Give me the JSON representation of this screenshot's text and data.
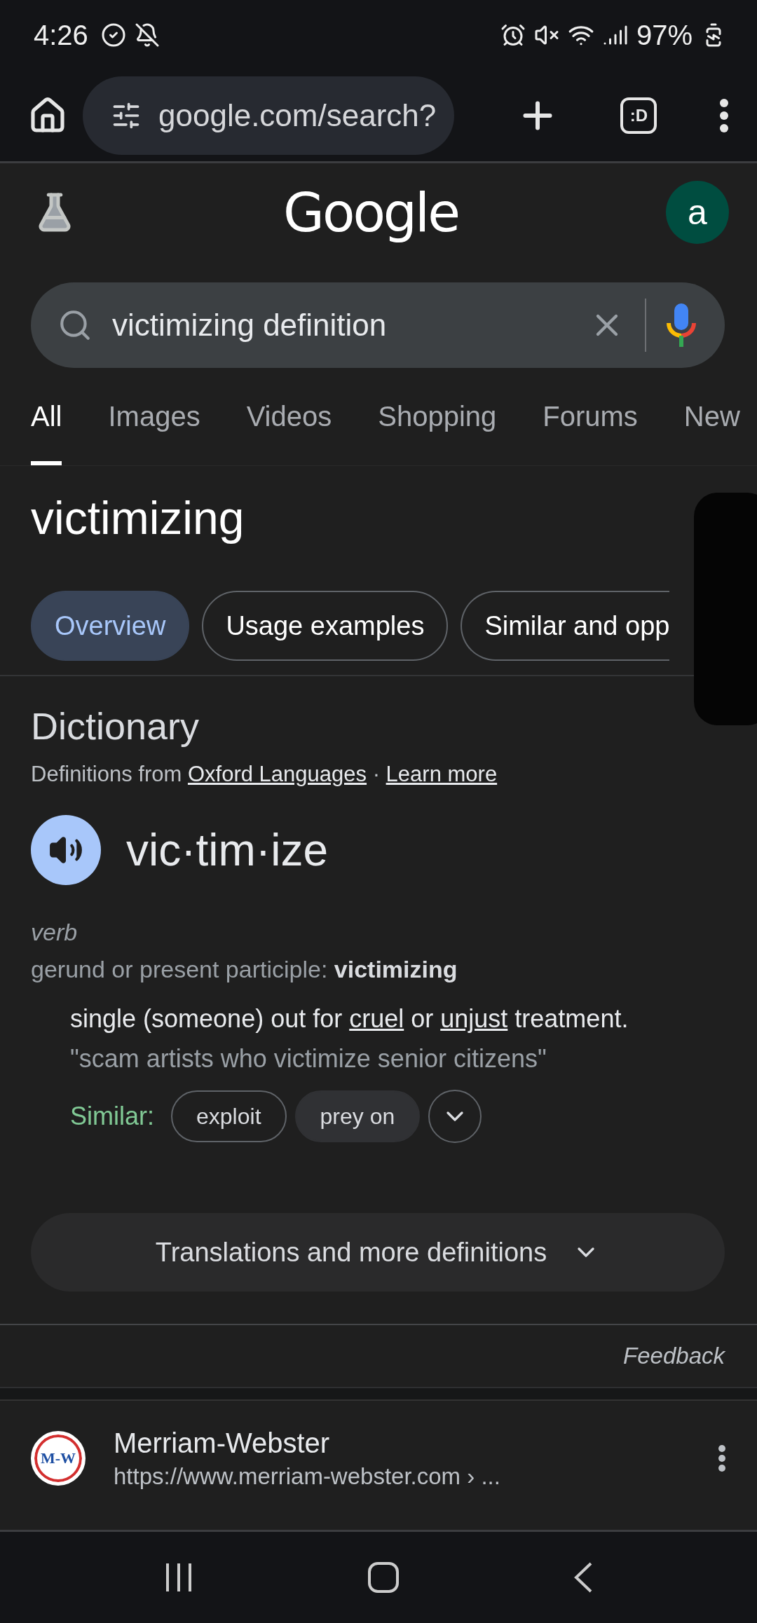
{
  "status_bar": {
    "time": "4:26",
    "battery": "97%"
  },
  "browser_bar": {
    "url": "google.com/search?",
    "tab_count": ":D"
  },
  "header": {
    "logo": "Google",
    "avatar": "a"
  },
  "search": {
    "value": "victimizing definition"
  },
  "tabs": [
    {
      "label": "All",
      "selected": true
    },
    {
      "label": "Images",
      "selected": false
    },
    {
      "label": "Videos",
      "selected": false
    },
    {
      "label": "Shopping",
      "selected": false
    },
    {
      "label": "Forums",
      "selected": false
    },
    {
      "label": "New",
      "selected": false
    }
  ],
  "query_title": "victimizing",
  "chips": [
    {
      "label": "Overview",
      "selected": true
    },
    {
      "label": "Usage examples",
      "selected": false
    },
    {
      "label": "Similar and opp",
      "selected": false
    }
  ],
  "dictionary": {
    "heading": "Dictionary",
    "source": [
      {
        "text": "Definitions from ",
        "link": false
      },
      {
        "text": "Oxford Languages",
        "link": true
      },
      {
        "text": " · ",
        "link": false
      },
      {
        "text": "Learn more",
        "link": true
      }
    ],
    "word": "vic·tim·ize",
    "part_of_speech": "verb",
    "inflection": "gerund or present participle: **victimizing**",
    "definition": [
      {
        "text": "single (someone) out for ",
        "link": false
      },
      {
        "text": "cruel",
        "link": true
      },
      {
        "text": " or ",
        "link": false
      },
      {
        "text": "unjust",
        "link": true
      },
      {
        "text": " treatment.",
        "link": false
      }
    ],
    "example": "\"scam artists who victimize senior citizens\"",
    "similar_label": "Similar:",
    "similar": [
      {
        "label": "exploit",
        "highlighted": false
      },
      {
        "label": "prey on",
        "highlighted": true
      }
    ],
    "more_button": "Translations and more definitions"
  },
  "feedback": "Feedback",
  "result": {
    "favicon": "M-W",
    "site": "Merriam-Webster",
    "url": "https://www.merriam-webster.com › ..."
  }
}
